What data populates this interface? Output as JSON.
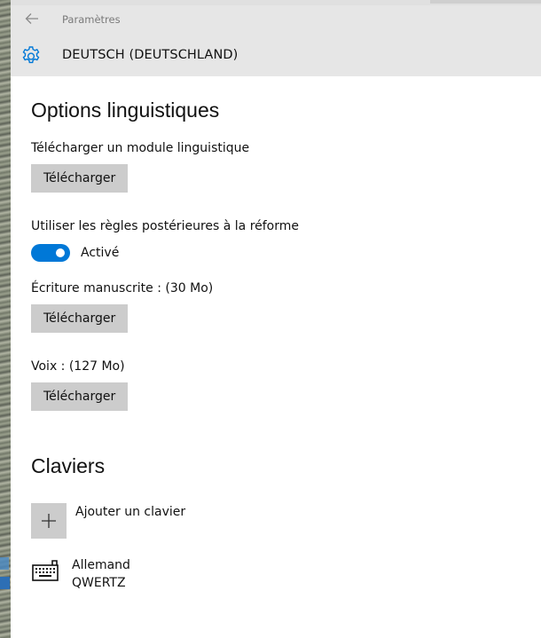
{
  "window": {
    "title": "Paramètres"
  },
  "header": {
    "title": "DEUTSCH (DEUTSCHLAND)",
    "icon": "gear-icon",
    "accent": "#0078d7"
  },
  "language_options": {
    "heading": "Options linguistiques",
    "language_pack": {
      "label": "Télécharger un module linguistique",
      "button": "Télécharger"
    },
    "reform_rules": {
      "label": "Utiliser les règles postérieures à la réforme",
      "toggle_state": "Activé",
      "enabled": true
    },
    "handwriting": {
      "label": "Écriture manuscrite : (30 Mo)",
      "button": "Télécharger"
    },
    "voice": {
      "label": "Voix : (127 Mo)",
      "button": "Télécharger"
    }
  },
  "keyboards": {
    "heading": "Claviers",
    "add_label": "Ajouter un clavier",
    "items": [
      {
        "name": "Allemand",
        "layout": "QWERTZ",
        "icon": "keyboard-icon"
      }
    ]
  }
}
